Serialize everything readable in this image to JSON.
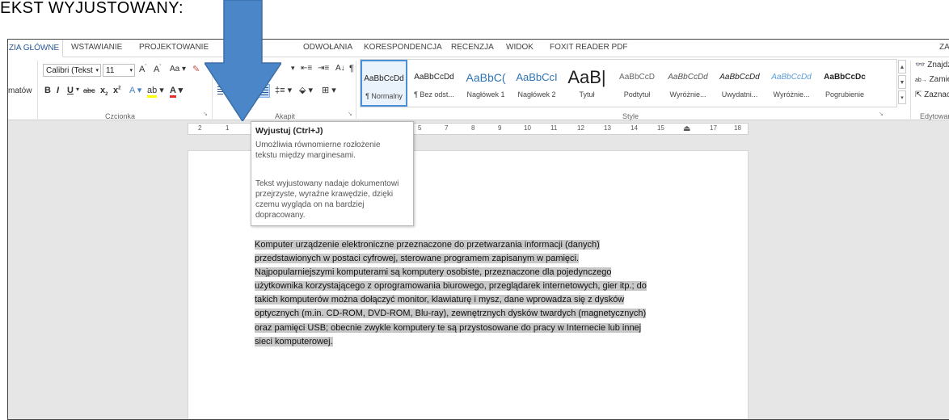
{
  "heading": "EKST WYJUSTOWANY:",
  "tabs": [
    "ZIA GŁÓWNE",
    "WSTAWIANIE",
    "PROJEKTOWANIE",
    "ODWOŁANIA",
    "KORESPONDENCJA",
    "RECENZJA",
    "WIDOK",
    "FOXIT READER PDF",
    "ZA"
  ],
  "ribbon": {
    "clipboard_partial_label": "matów",
    "font_name": "Calibri (Tekst",
    "font_size": "11",
    "group_labels": {
      "font": "Czcionka",
      "paragraph": "Akapit",
      "styles": "Style",
      "editing": "Edytowanie"
    },
    "styles": [
      {
        "sample": "AaBbCcDd",
        "name": "¶ Normalny"
      },
      {
        "sample": "AaBbCcDd",
        "name": "¶ Bez odst..."
      },
      {
        "sample": "AaBbC(",
        "name": "Nagłówek 1"
      },
      {
        "sample": "AaBbCcI",
        "name": "Nagłówek 2"
      },
      {
        "sample": "AaB|",
        "name": "Tytuł"
      },
      {
        "sample": "AaBbCcD",
        "name": "Podtytuł"
      },
      {
        "sample": "AaBbCcDd",
        "name": "Wyróżnie..."
      },
      {
        "sample": "AaBbCcDd",
        "name": "Uwydatni..."
      },
      {
        "sample": "AaBbCcDd",
        "name": "Wyróżnie..."
      },
      {
        "sample": "AaBbCcDc",
        "name": "Pogrubienie"
      }
    ],
    "editing": {
      "find": "Znajdź",
      "replace": "Zamień",
      "select": "Zaznacz"
    }
  },
  "ruler_ticks": [
    "2",
    "1",
    "5",
    "7",
    "8",
    "9",
    "10",
    "11",
    "12",
    "13",
    "14",
    "15",
    "17",
    "18"
  ],
  "tooltip": {
    "title": "Wyjustuj (Ctrl+J)",
    "line1": "Umożliwia równomierne rozłożenie tekstu między marginesami.",
    "line2": "Tekst wyjustowany nadaje dokumentowi przejrzyste, wyraźne krawędzie, dzięki czemu wygląda on na bardziej dopracowany."
  },
  "document": {
    "lines": [
      "Komputer urządzenie elektroniczne przeznaczone do przetwarzania informacji (danych)",
      "przedstawionych w postaci cyfrowej, sterowane programem zapisanym w pamięci.",
      "Najpopularniejszymi komputerami są komputery osobiste, przeznaczone dla pojedynczego",
      "użytkownika korzystającego z oprogramowania biurowego, przeglądarek internetowych, gier itp.; do",
      "takich komputerów można dołączyć monitor, klawiaturę i mysz, dane wprowadza się z dysków",
      "optycznych (m.in. CD-ROM, DVD-ROM, Blu-ray), zewnętrznych dysków twardych (magnetycznych)",
      "oraz pamięci USB; obecnie zwykle komputery te są przystosowane do pracy w Internecie lub innej",
      "sieci komputerowej."
    ]
  },
  "colors": {
    "accent": "#2b5797",
    "arrow": "#4a86c8",
    "highlight": "#c8c8c8"
  }
}
